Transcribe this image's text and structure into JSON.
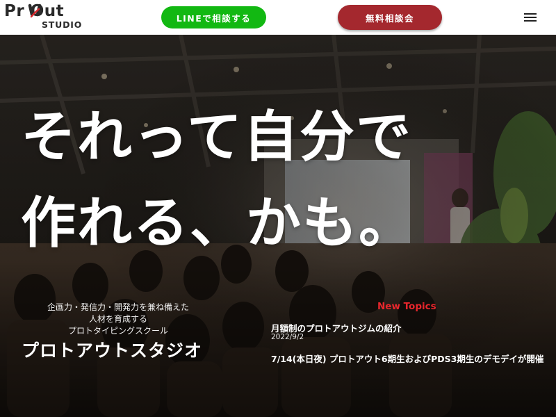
{
  "header": {
    "logo_main": "Pr  Out",
    "logo_sub": "STUDIO",
    "line_button": "LINEで相談する",
    "consult_button": "無料相談会",
    "menu_icon": "hamburger-menu-icon"
  },
  "hero": {
    "headline_line1": "それって自分で",
    "headline_line2": "作れる、かも。",
    "tagline": [
      "企画力・発信力・開発力を兼ね備えた",
      "人材を育成する",
      "プロトタイピングスクール"
    ],
    "brand_title": "プロトアウトスタジオ"
  },
  "topics": {
    "heading": "New Topics",
    "items": [
      {
        "title": "月額制のプロトアウトジムの紹介",
        "date": "2022/9/2"
      },
      {
        "title": "7/14(本日夜) プロトアウト6期生およびPDS3期生のデモデイが開催",
        "date": ""
      }
    ]
  },
  "colors": {
    "line_green": "#12b812",
    "consult_red": "#a4282e",
    "topics_red": "#e8262c",
    "header_bg": "#ffffff"
  }
}
